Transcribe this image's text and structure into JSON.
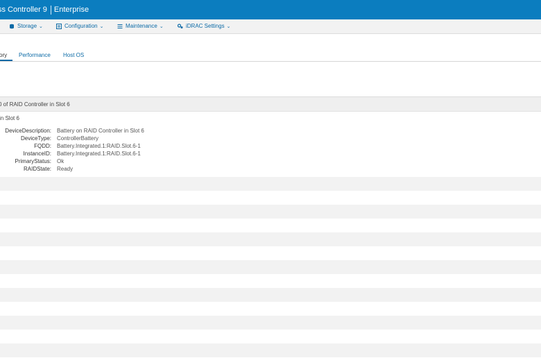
{
  "banner": {
    "product": "ss Controller 9",
    "edition": "Enterprise"
  },
  "menu": [
    {
      "label": "Storage",
      "icon": "storage-icon"
    },
    {
      "label": "Configuration",
      "icon": "configuration-icon"
    },
    {
      "label": "Maintenance",
      "icon": "maintenance-icon"
    },
    {
      "label": "iDRAC Settings",
      "icon": "idrac-settings-icon"
    }
  ],
  "tabs": [
    {
      "label": "ory",
      "active": true
    },
    {
      "label": "Performance",
      "active": false
    },
    {
      "label": "Host OS",
      "active": false
    }
  ],
  "group": {
    "header": "0 of RAID Controller in Slot 6",
    "subheader": "in Slot 6",
    "properties": [
      {
        "key": "DeviceDescription:",
        "value": "Battery on RAID Controller in Slot 6"
      },
      {
        "key": "DeviceType:",
        "value": "ControllerBattery"
      },
      {
        "key": "FQDD:",
        "value": "Battery.Integrated.1:RAID.Slot.6-1"
      },
      {
        "key": "InstanceID:",
        "value": "Battery.Integrated.1:RAID.Slot.6-1"
      },
      {
        "key": "PrimaryStatus:",
        "value": "Ok"
      },
      {
        "key": "RAIDState:",
        "value": "Ready"
      }
    ]
  },
  "colors": {
    "banner": "#0b7dbf",
    "link": "#0b6aa6",
    "stripe": "#f2f2f2"
  }
}
